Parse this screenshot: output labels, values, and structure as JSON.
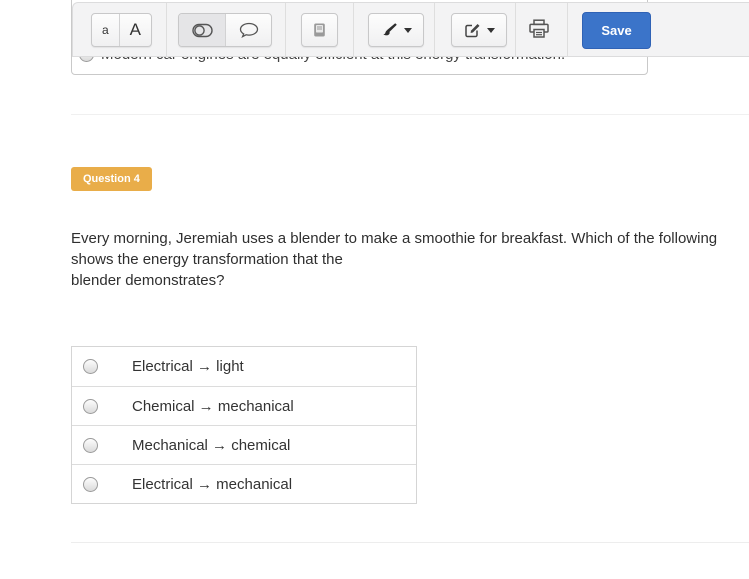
{
  "toolbar": {
    "text_small_label": "a",
    "text_large_label": "A",
    "save_label": "Save",
    "save_color": "#3b74c9",
    "icons": {
      "toggle": "toggle-icon",
      "comment": "speech-bubble-icon",
      "book": "book-icon",
      "brush": "brush-icon",
      "edit": "edit-square-icon",
      "print": "printer-icon",
      "dropdown": "chevron-down-icon"
    }
  },
  "previous_question": {
    "clipped_option_text": "Modern car engines are equally efficient at this energy transformation."
  },
  "question": {
    "badge_label": "Question 4",
    "badge_color": "#e9ad49",
    "prompt_part1": "Every morning, Jeremiah uses a blender to make a smoothie for breakfast. Which of the following shows the energy transformation that the",
    "prompt_part2": "blender demonstrates?"
  },
  "options": [
    {
      "label": "Electrical → light"
    },
    {
      "label": "Chemical → mechanical"
    },
    {
      "label": "Mechanical → chemical"
    },
    {
      "label": "Electrical → mechanical"
    }
  ]
}
